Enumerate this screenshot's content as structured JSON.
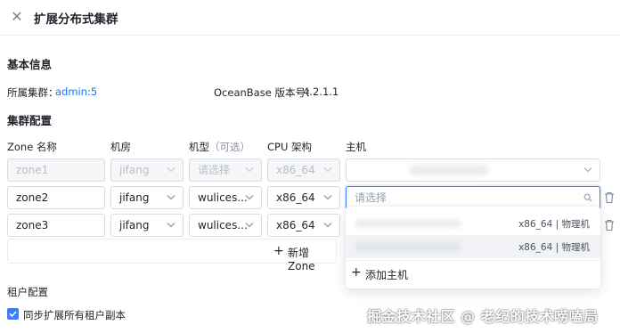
{
  "header": {
    "title": "扩展分布式集群",
    "close_icon": "close-icon"
  },
  "basic_info": {
    "section_title": "基本信息",
    "cluster_label": "所属集群：",
    "cluster_value": "admin:5",
    "version_label": "OceanBase 版本号：",
    "version_value": "4.2.1.1"
  },
  "cluster_config": {
    "section_title": "集群配置",
    "columns": {
      "zone_name": "Zone 名称",
      "idc": "机房",
      "machine_type": "机型",
      "machine_type_hint": "（可选）",
      "cpu_arch": "CPU 架构",
      "host": "主机"
    },
    "rows": [
      {
        "zone": "zone1",
        "idc": "jifang",
        "machine_type": "请选择",
        "cpu_arch": "x86_64",
        "host": "",
        "disabled": true
      },
      {
        "zone": "zone2",
        "idc": "jifang",
        "machine_type": "wulices...",
        "cpu_arch": "x86_64",
        "host_placeholder": "请选择",
        "disabled": false
      },
      {
        "zone": "zone3",
        "idc": "jifang",
        "machine_type": "wulices...",
        "cpu_arch": "x86_64",
        "host": "",
        "disabled": false
      }
    ],
    "add_zone_label": "新增Zone"
  },
  "host_dropdown": {
    "options": [
      {
        "meta": "x86_64 | 物理机"
      },
      {
        "meta": "x86_64 | 物理机"
      }
    ],
    "add_host_label": "添加主机"
  },
  "tenant_config": {
    "section_title": "租户配置",
    "sync_checkbox_label": "同步扩展所有租户副本",
    "sync_checked": true
  },
  "watermark": "掘金技术社区 @ 老纪的技术唠嗑局",
  "colors": {
    "accent": "#1677ff",
    "focus_border": "#3f7cf5",
    "checkbox": "#3f7cf5"
  }
}
